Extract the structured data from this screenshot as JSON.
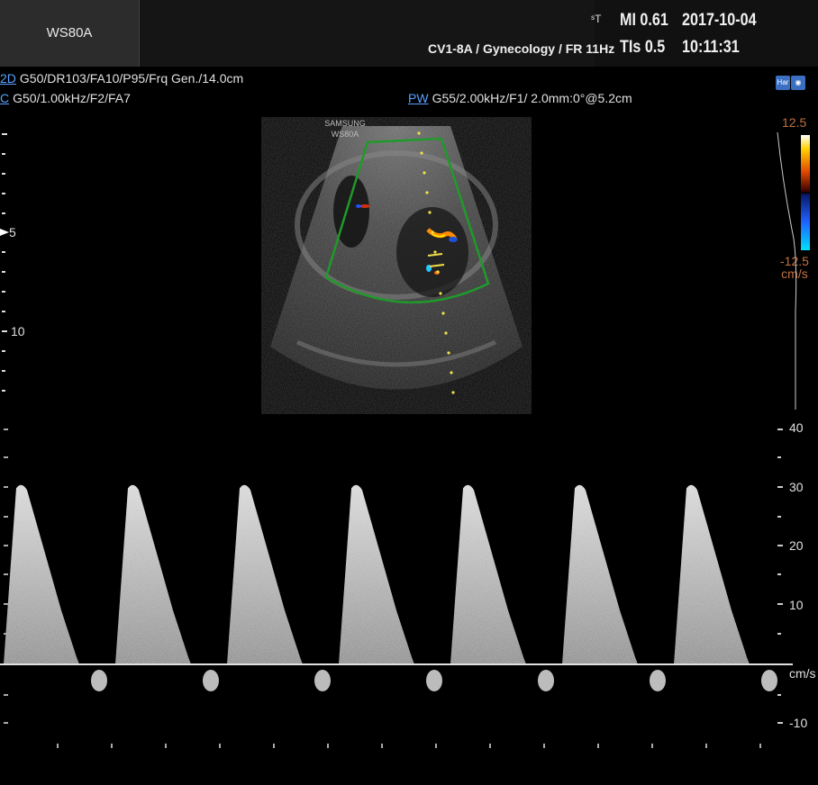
{
  "header": {
    "logo": "WS80A",
    "probe_info": "CV1-8A / Gynecology / FR 11Hz",
    "truncated_mark": "ˢT",
    "mi": "MI  0.61",
    "tis": "TIs 0.5",
    "date": "2017-10-04",
    "time": "10:11:31"
  },
  "params": {
    "mode_2d": "2D",
    "line_2d": "G50/DR103/FA10/P95/Frq Gen./14.0cm",
    "mode_c": "C",
    "line_c": "G50/1.00kHz/F2/FA7",
    "mode_pw": "PW",
    "line_pw": "G55/2.00kHz/F1/ 2.0mm:0°@5.2cm"
  },
  "icons": {
    "har": "Har",
    "probe": "probe-status-icon"
  },
  "image": {
    "watermark_line1": "SAMSUNG",
    "watermark_line2": "WS80A",
    "depth_labels": [
      "5",
      "10"
    ]
  },
  "color_bar": {
    "top": "12.5",
    "bottom": "-12.5",
    "unit": "cm/s"
  },
  "doppler": {
    "scale_labels": [
      "40",
      "30",
      "20",
      "10",
      "-10"
    ],
    "unit": "cm/s",
    "peak_velocity_cm_s": 31,
    "cycles": 7
  },
  "colors": {
    "accent": "#5aa0ff",
    "roi": "#1f9a2a",
    "cursor": "#f2e14a",
    "scale_label": "#c2703e"
  }
}
